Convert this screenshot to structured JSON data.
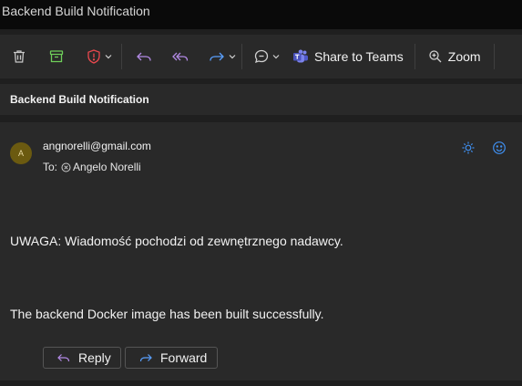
{
  "window": {
    "title": "Backend Build Notification"
  },
  "toolbar": {
    "share_label": "Share to Teams",
    "zoom_label": "Zoom"
  },
  "message": {
    "subject": "Backend Build Notification",
    "sender": "angnorelli@gmail.com",
    "avatar_initial": "A",
    "to_prefix": "To:",
    "to_name": "Angelo Norelli",
    "warning": "UWAGA: Wiadomość pochodzi od zewnętrznego nadawcy.",
    "body": "The backend Docker image has been built successfully."
  },
  "actions": {
    "reply_label": "Reply",
    "forward_label": "Forward"
  },
  "colors": {
    "delete": "#c7c7c7",
    "archive": "#6fcf5a",
    "report": "#e8484d",
    "reply_arrows": "#b38ae6",
    "forward_arrow": "#5aa0ff",
    "teams": "#7b83eb",
    "header_icons": "#3f8ff0"
  }
}
